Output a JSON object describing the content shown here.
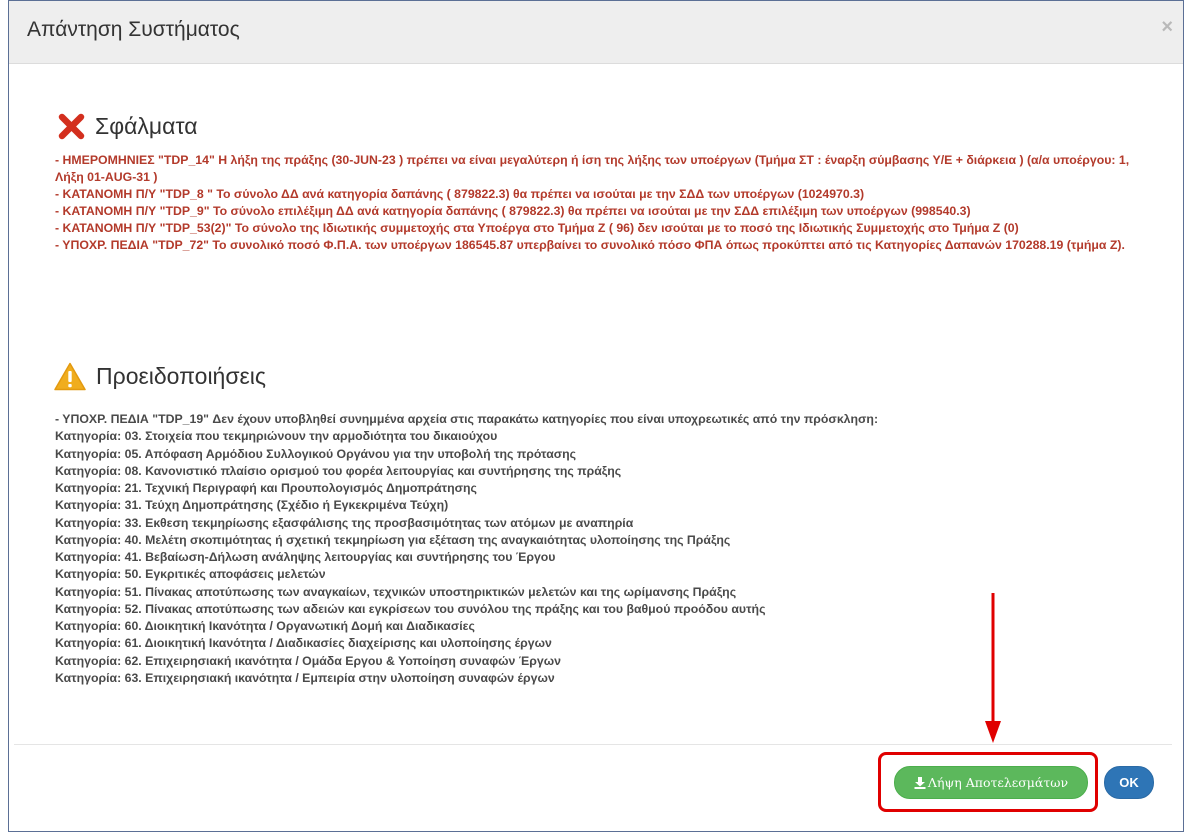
{
  "dialog": {
    "title": "Απάντηση Συστήματος",
    "close_symbol": "×"
  },
  "errors": {
    "title": "Σφάλματα",
    "icon": "error-x-icon",
    "color": "#b33a2b",
    "lines": [
      "- ΗΜΕΡΟΜΗΝΙΕΣ \"TDP_14\" Η λήξη της πράξης (30-JUN-23 ) πρέπει να είναι μεγαλύτερη ή ίση της λήξης των υποέργων (Τμήμα ΣΤ : έναρξη σύμβασης Υ/Ε + διάρκεια ) (α/α υποέργου: 1, Λήξη 01-AUG-31 )",
      "- ΚΑΤΑΝΟΜΗ Π/Υ \"TDP_8 \" Το σύνολο ΔΔ ανά κατηγορία δαπάνης ( 879822.3) θα πρέπει να ισούται με την ΣΔΔ των υποέργων (1024970.3)",
      "- ΚΑΤΑΝΟΜΗ Π/Υ \"TDP_9\" Το σύνολο επιλέξιμη ΔΔ ανά κατηγορία δαπάνης ( 879822.3) θα πρέπει να ισούται με την ΣΔΔ επιλέξιμη των υποέργων (998540.3)",
      "- ΚΑΤΑΝΟΜΗ Π/Υ \"TDP_53(2)\" Το σύνολο της Ιδιωτικής συμμετοχής στα Υποέργα στο Τμήμα Ζ ( 96) δεν ισούται με το ποσό της Ιδιωτικής Συμμετοχής στο Τμήμα Ζ (0)",
      "- ΥΠΟΧΡ. ΠΕΔΙΑ \"TDP_72\" Το συνολικό ποσό Φ.Π.Α. των υποέργων 186545.87 υπερβαίνει το συνολικό πόσο ΦΠΑ όπως προκύπτει από τις Κατηγορίες Δαπανών 170288.19 (τμήμα Ζ)."
    ]
  },
  "warnings": {
    "title": "Προειδοποιήσεις",
    "icon": "warning-triangle-icon",
    "color": "#f0ad1e",
    "lines": [
      "- ΥΠΟΧΡ. ΠΕΔΙΑ \"TDP_19\" Δεν έχουν υποβληθεί συνημμένα αρχεία στις παρακάτω κατηγορίες που είναι υποχρεωτικές από την πρόσκληση:",
      "Κατηγορία: 03. Στοιχεία που τεκμηριώνουν την αρμοδιότητα του δικαιούχου",
      "Κατηγορία: 05. Απόφαση Αρμόδιου Συλλογικού Οργάνου για την υποβολή της πρότασης",
      "Κατηγορία: 08. Κανονιστικό πλαίσιο ορισμού του φορέα λειτουργίας και συντήρησης της πράξης",
      "Κατηγορία: 21. Τεχνική Περιγραφή και Προυπολογισμός Δημοπράτησης",
      "Κατηγορία: 31. Τεύχη Δημοπράτησης (Σχέδιο ή Εγκεκριμένα Τεύχη)",
      "Κατηγορία: 33. Εκθεση τεκμηρίωσης εξασφάλισης της προσβασιμότητας των ατόμων με αναπηρία",
      "Κατηγορία: 40. Μελέτη σκοπιμότητας ή σχετική τεκμηρίωση για εξέταση της αναγκαιότητας υλοποίησης της Πράξης",
      "Κατηγορία: 41. Βεβαίωση-Δήλωση ανάληψης λειτουργίας και συντήρησης του Έργου",
      "Κατηγορία: 50. Εγκριτικές αποφάσεις μελετών",
      "Κατηγορία: 51. Πίνακας αποτύπωσης των αναγκαίων, τεχνικών υποστηρικτικών μελετών και της ωρίμανσης Πράξης",
      "Κατηγορία: 52. Πίνακας αποτύπωσης των αδειών και εγκρίσεων του συνόλου της πράξης και του βαθμού προόδου αυτής",
      "Κατηγορία: 60. Διοικητική Ικανότητα / Οργανωτική Δομή και Διαδικασίες",
      "Κατηγορία: 61. Διοικητική Ικανότητα / Διαδικασίες διαχείρισης και υλοποίησης έργων",
      "Κατηγορία: 62. Επιχειρησιακή ικανότητα / Ομάδα Εργου & Υοποίηση συναφών Έργων",
      "Κατηγορία: 63. Επιχειρησιακή ικανότητα / Εμπειρία στην υλοποίηση συναφών έργων"
    ]
  },
  "footer": {
    "download_label": "Λήψη Αποτελεσμάτων",
    "download_icon": "download-icon",
    "ok_label": "OK",
    "download_color": "#5cb85c",
    "ok_color": "#2e75b6",
    "annotation_color": "#e00000"
  }
}
